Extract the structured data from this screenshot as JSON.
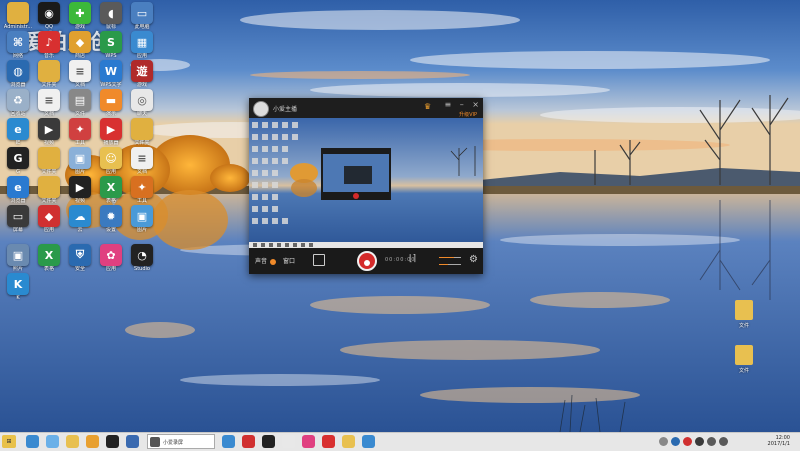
{
  "watermark": {
    "text": "爱拍原创"
  },
  "desktop": {
    "icons": [
      {
        "name": "Administrator",
        "label": "Administr...",
        "icon": "folder-user-icon",
        "color": "#e0b040"
      },
      {
        "name": "qq",
        "label": "QQ",
        "icon": "qq-penguin-icon",
        "color": "#1a1a1a"
      },
      {
        "name": "game",
        "label": "游戏",
        "icon": "game-clover-icon",
        "color": "#3cb83a"
      },
      {
        "name": "mouse",
        "label": "鼠标",
        "icon": "mouse-icon",
        "color": "#5a5a5a"
      },
      {
        "name": "computer",
        "label": "此电脑",
        "icon": "computer-icon",
        "color": "#4a7fc0"
      },
      {
        "name": "network",
        "label": "网络",
        "icon": "network-icon",
        "color": "#4a7fc0"
      },
      {
        "name": "music",
        "label": "音乐",
        "icon": "music-icon",
        "color": "#d83030"
      },
      {
        "name": "store",
        "label": "商店",
        "icon": "store-icon",
        "color": "#e0a030"
      },
      {
        "name": "wps",
        "label": "WPS",
        "icon": "wps-icon",
        "color": "#2a9a4a"
      },
      {
        "name": "app-grid",
        "label": "应用",
        "icon": "app-grid-icon",
        "color": "#3a8ad0"
      },
      {
        "name": "browser",
        "label": "浏览器",
        "icon": "browser-globe-icon",
        "color": "#2a6ab0"
      },
      {
        "name": "folder1",
        "label": "文件夹",
        "icon": "folder-icon",
        "color": "#e0b040"
      },
      {
        "name": "doc1",
        "label": "文档",
        "icon": "document-icon",
        "color": "#f0f0f0"
      },
      {
        "name": "wps-w",
        "label": "WPS文字",
        "icon": "wps-writer-icon",
        "color": "#2a7ad0"
      },
      {
        "name": "game2",
        "label": "游戏",
        "icon": "game-icon",
        "color": "#b02a2a"
      },
      {
        "name": "recycle",
        "label": "回收站",
        "icon": "recycle-bin-icon",
        "color": "#9ab0c8"
      },
      {
        "name": "doc2",
        "label": "文档",
        "icon": "document-icon",
        "color": "#f0f0f0"
      },
      {
        "name": "file1",
        "label": "文件",
        "icon": "file-icon",
        "color": "#888888"
      },
      {
        "name": "slides",
        "label": "演示",
        "icon": "slides-icon",
        "color": "#f08a2a"
      },
      {
        "name": "chat",
        "label": "聊天",
        "icon": "chat-icon",
        "color": "#e8e8e8"
      },
      {
        "name": "ie",
        "label": "IE",
        "icon": "ie-browser-icon",
        "color": "#2a8ad0"
      },
      {
        "name": "video",
        "label": "视频",
        "icon": "video-icon",
        "color": "#3a3a3a"
      },
      {
        "name": "tool",
        "label": "工具",
        "icon": "tool-icon",
        "color": "#d04040"
      },
      {
        "name": "player",
        "label": "播放器",
        "icon": "player-icon",
        "color": "#d83030"
      },
      {
        "name": "folder2",
        "label": "文件夹",
        "icon": "folder-icon",
        "color": "#e0b040"
      },
      {
        "name": "g-app",
        "label": "G",
        "icon": "g-app-icon",
        "color": "#222222"
      },
      {
        "name": "folder3",
        "label": "文件夹",
        "icon": "folder-icon",
        "color": "#e0b040"
      },
      {
        "name": "image1",
        "label": "图片",
        "icon": "image-icon",
        "color": "#8ab0d8"
      },
      {
        "name": "face-app",
        "label": "应用",
        "icon": "face-app-icon",
        "color": "#e8c050"
      },
      {
        "name": "doc3",
        "label": "文档",
        "icon": "document-icon",
        "color": "#f0f0f0"
      },
      {
        "name": "edge",
        "label": "浏览器",
        "icon": "edge-browser-icon",
        "color": "#2a7ad0"
      },
      {
        "name": "folder4",
        "label": "文件夹",
        "icon": "folder-icon",
        "color": "#e0b040"
      },
      {
        "name": "video2",
        "label": "视频",
        "icon": "video-icon",
        "color": "#222222"
      },
      {
        "name": "excel",
        "label": "表格",
        "icon": "spreadsheet-icon",
        "color": "#2a9a4a"
      },
      {
        "name": "tool2",
        "label": "工具",
        "icon": "tool-icon",
        "color": "#d87020"
      },
      {
        "name": "screen",
        "label": "屏幕",
        "icon": "screen-icon",
        "color": "#3a3a3a"
      },
      {
        "name": "app3",
        "label": "应用",
        "icon": "app-icon",
        "color": "#d03030"
      },
      {
        "name": "cloud",
        "label": "云",
        "icon": "cloud-icon",
        "color": "#2a8ad0"
      },
      {
        "name": "settings",
        "label": "设置",
        "icon": "settings-gear-icon",
        "color": "#3a7ac0"
      },
      {
        "name": "image2",
        "label": "图片",
        "icon": "image-icon",
        "color": "#4a9ad8"
      },
      {
        "name": "photo",
        "label": "照片",
        "icon": "photo-icon",
        "color": "#6a8ab0"
      },
      {
        "name": "excel2",
        "label": "表格",
        "icon": "spreadsheet-icon",
        "color": "#2a9a4a"
      },
      {
        "name": "shield",
        "label": "安全",
        "icon": "shield-icon",
        "color": "#2a6ab0"
      },
      {
        "name": "colorful",
        "label": "应用",
        "icon": "colorful-app-icon",
        "color": "#e04080"
      },
      {
        "name": "obs",
        "label": "Studio",
        "icon": "obs-icon",
        "color": "#222222"
      },
      {
        "name": "k-app",
        "label": "K",
        "icon": "k-app-icon",
        "color": "#2a8ad0"
      }
    ],
    "right_icons": [
      {
        "label": "文件",
        "icon": "folder-icon"
      },
      {
        "label": "文件",
        "icon": "folder-icon"
      }
    ]
  },
  "recorder": {
    "username": "小爱主播",
    "crown_icon": "crown-icon",
    "upgrade_label": "升级VIP",
    "controls": {
      "audio_label": "声音",
      "mode_label": "窗口",
      "timer": "00:00:00",
      "settings_icon": "gear-icon",
      "volume": 0.7
    }
  },
  "taskbar": {
    "active_window_label": "小爱录屏",
    "clock_time": "12:00",
    "clock_date": "2017/1/1"
  }
}
